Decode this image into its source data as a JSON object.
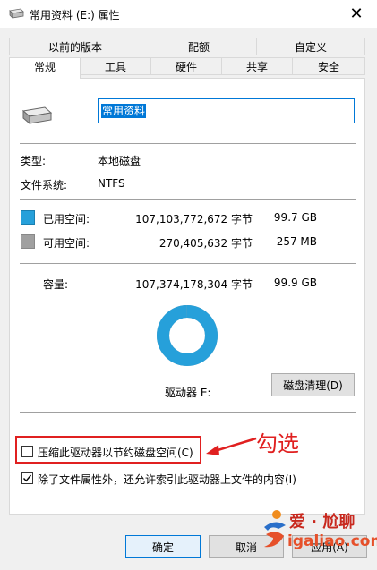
{
  "window": {
    "title": "常用资料 (E:) 属性",
    "close_symbol": "✕"
  },
  "tabs_row1": [
    {
      "label": "以前的版本"
    },
    {
      "label": "配额"
    },
    {
      "label": "自定义"
    }
  ],
  "tabs_row2": [
    {
      "label": "常规",
      "active": true
    },
    {
      "label": "工具"
    },
    {
      "label": "硬件"
    },
    {
      "label": "共享"
    },
    {
      "label": "安全"
    }
  ],
  "general": {
    "drive_name": "常用资料",
    "type_label": "类型:",
    "type_value": "本地磁盘",
    "fs_label": "文件系统:",
    "fs_value": "NTFS",
    "used_label": "已用空间:",
    "used_bytes": "107,103,772,672 字节",
    "used_size": "99.7 GB",
    "free_label": "可用空间:",
    "free_bytes": "270,405,632 字节",
    "free_size": "257 MB",
    "capacity_label": "容量:",
    "capacity_bytes": "107,374,178,304 字节",
    "capacity_size": "99.9 GB",
    "drive_label": "驱动器 E:",
    "cleanup_button": "磁盘清理(D)",
    "compress_label": "压缩此驱动器以节约磁盘空间(C)",
    "compress_checked": false,
    "index_label": "除了文件属性外，还允许索引此驱动器上文件的内容(I)",
    "index_checked": true
  },
  "donut": {
    "used_fraction": 0.9975,
    "used_color": "#26a0da",
    "free_color": "#a0a0a0"
  },
  "footer": {
    "ok_button": "确定",
    "cancel_button": "取消",
    "apply_button": "应用(A)"
  },
  "annotation": {
    "text": "勾选",
    "color": "#e02020"
  },
  "watermark": {
    "brand": "爱 · 尬聊",
    "url": "igaliao.com"
  }
}
